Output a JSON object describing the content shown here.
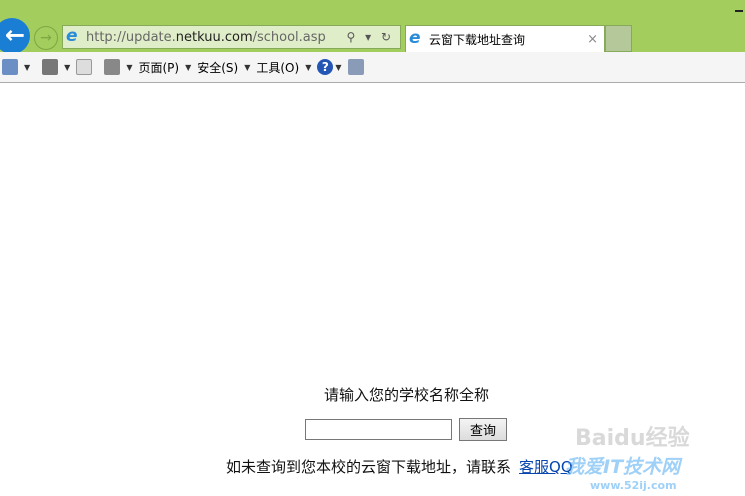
{
  "browser": {
    "url_prefix": "http://update.",
    "url_domain": "netkuu.com",
    "url_suffix": "/school.asp",
    "search_refresh": "⚲ ▾ ↻",
    "tab_title": "云窗下载地址查询",
    "tab_close": "×"
  },
  "commandbar": {
    "page": "页面(P)",
    "safety": "安全(S)",
    "tools": "工具(O)",
    "help": "?"
  },
  "page": {
    "prompt": "请输入您的学校名称全称",
    "search_value": "",
    "search_button": "查询",
    "note": "如未查询到您本校的云窗下载地址，请联系",
    "link": "客服QQ"
  },
  "watermark": {
    "line1": "Baidu经验",
    "line2": "我爱IT技术网",
    "line3": "www.52ij.com"
  }
}
